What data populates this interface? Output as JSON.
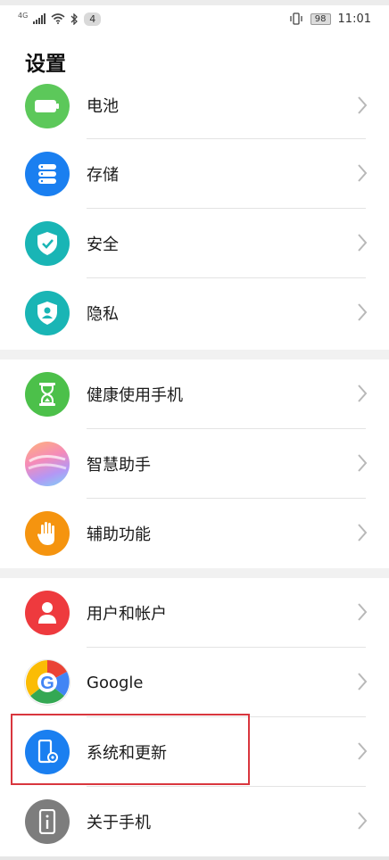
{
  "status_bar": {
    "network": "4G",
    "notif_count": "4",
    "battery": "98",
    "time": "11:01"
  },
  "page": {
    "title": "设置"
  },
  "groups": [
    {
      "items": [
        {
          "label": "电池",
          "icon": "battery-icon",
          "color": "#5cc85a"
        },
        {
          "label": "存储",
          "icon": "storage-icon",
          "color": "#1a7ff0"
        },
        {
          "label": "安全",
          "icon": "shield-check-icon",
          "color": "#19b5b5"
        },
        {
          "label": "隐私",
          "icon": "privacy-icon",
          "color": "#19b5b5"
        }
      ]
    },
    {
      "items": [
        {
          "label": "健康使用手机",
          "icon": "hourglass-icon",
          "color": "#4cc04a"
        },
        {
          "label": "智慧助手",
          "icon": "assistant-icon",
          "color": "gradient"
        },
        {
          "label": "辅助功能",
          "icon": "hand-icon",
          "color": "#f5940f"
        }
      ]
    },
    {
      "items": [
        {
          "label": "用户和帐户",
          "icon": "user-icon",
          "color": "#ee3a3e"
        },
        {
          "label": "Google",
          "icon": "google-icon",
          "color": "#ffffff"
        },
        {
          "label": "系统和更新",
          "icon": "system-update-icon",
          "color": "#1a7ff0"
        },
        {
          "label": "关于手机",
          "icon": "about-phone-icon",
          "color": "#7d7d7d"
        }
      ]
    }
  ]
}
